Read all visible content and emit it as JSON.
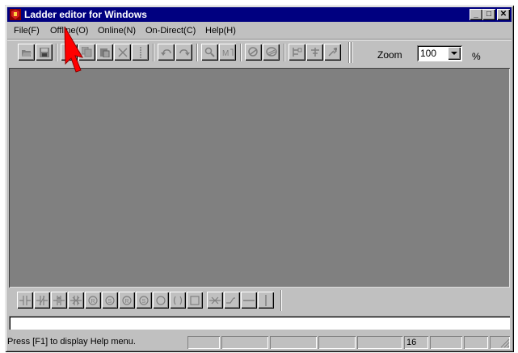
{
  "window": {
    "title": "Ladder editor for Windows",
    "controls": {
      "minimize": "_",
      "maximize": "□",
      "close": "✕"
    }
  },
  "menu": [
    {
      "label": "File(F)",
      "name": "menu-file"
    },
    {
      "label": "Offline(O)",
      "name": "menu-offline"
    },
    {
      "label": "Online(N)",
      "name": "menu-online"
    },
    {
      "label": "On-Direct(C)",
      "name": "menu-on-direct"
    },
    {
      "label": "Help(H)",
      "name": "menu-help"
    }
  ],
  "toolbar": {
    "buttons": [
      "open-icon",
      "save-icon",
      "cut-icon",
      "copy-icon",
      "paste-icon",
      "delete-icon",
      "insert-line-icon",
      "undo-icon",
      "redo-icon",
      "find-icon",
      "replace-icon",
      "cross-reference-icon",
      "compile-icon",
      "insert-rung-icon",
      "insert-branch-icon",
      "edit-rung-icon"
    ],
    "zoom_label": "Zoom",
    "zoom_value": "100",
    "zoom_unit": "%"
  },
  "ladder_toolbar": {
    "buttons": [
      "no-contact-icon",
      "nc-contact-icon",
      "rising-edge-contact-icon",
      "falling-edge-contact-icon",
      "reset-coil-icon",
      "set-coil-icon",
      "reset-coil-alt-icon",
      "set-coil-alt-icon",
      "coil-icon",
      "negated-coil-icon",
      "function-block-icon",
      "invert-icon",
      "diagonal-line-icon",
      "horizontal-line-icon",
      "vertical-line-icon"
    ]
  },
  "command_input": {
    "value": ""
  },
  "status": {
    "message": "Press [F1] to display Help menu.",
    "panes": [
      "",
      "",
      "",
      "",
      "",
      "16",
      "",
      "",
      ""
    ]
  },
  "colors": {
    "titlebar": "#000080",
    "workspace": "#808080",
    "face": "#c0c0c0",
    "cursor": "#ff0000"
  }
}
